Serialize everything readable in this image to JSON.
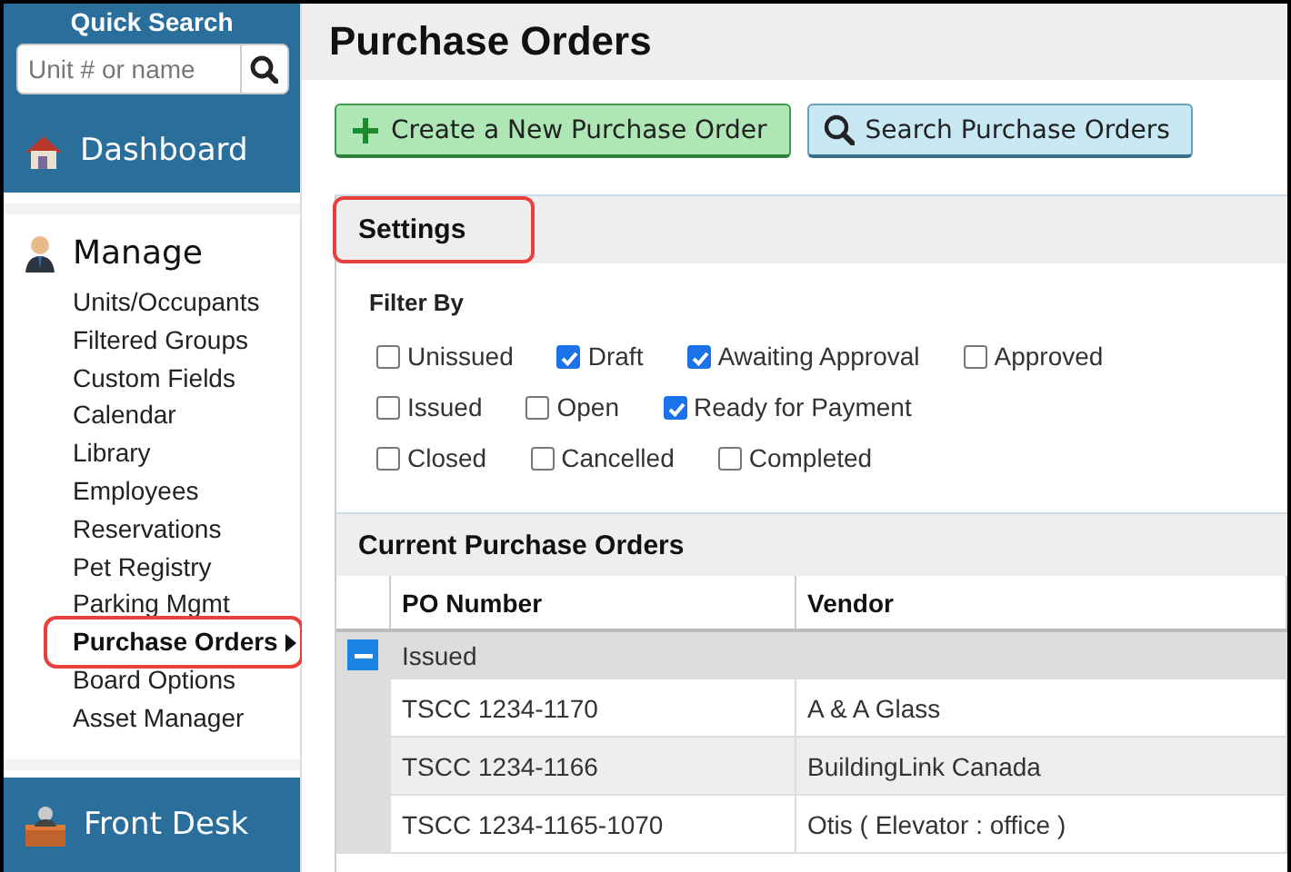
{
  "sidebar": {
    "quick_search": {
      "title": "Quick Search",
      "placeholder": "Unit # or name"
    },
    "dashboard": {
      "label": "Dashboard"
    },
    "manage": {
      "label": "Manage",
      "items": [
        {
          "label": "Units/Occupants",
          "selected": false,
          "highlighted": false
        },
        {
          "label": "Filtered Groups",
          "selected": false,
          "highlighted": false
        },
        {
          "label": "Custom Fields",
          "selected": false,
          "highlighted": false
        },
        {
          "label": "Calendar",
          "selected": false,
          "highlighted": false
        },
        {
          "label": "Library",
          "selected": false,
          "highlighted": false
        },
        {
          "label": "Employees",
          "selected": false,
          "highlighted": false
        },
        {
          "label": "Reservations",
          "selected": false,
          "highlighted": false
        },
        {
          "label": "Pet Registry",
          "selected": false,
          "highlighted": false
        },
        {
          "label": "Parking Mgmt",
          "selected": false,
          "highlighted": false
        },
        {
          "label": "Purchase Orders",
          "selected": true,
          "highlighted": true
        },
        {
          "label": "Board Options",
          "selected": false,
          "highlighted": false
        },
        {
          "label": "Asset Manager",
          "selected": false,
          "highlighted": false
        }
      ]
    },
    "front_desk": {
      "label": "Front Desk"
    }
  },
  "main": {
    "title": "Purchase Orders",
    "buttons": [
      {
        "label": "Create a New Purchase Order",
        "kind": "create"
      },
      {
        "label": "Search Purchase Orders",
        "kind": "search"
      }
    ],
    "settings": {
      "title": "Settings",
      "highlighted": true,
      "filter_label": "Filter By",
      "filter_rows": [
        [
          {
            "label": "Unissued",
            "checked": false
          },
          {
            "label": "Draft",
            "checked": true
          },
          {
            "label": "Awaiting Approval",
            "checked": true
          },
          {
            "label": "Approved",
            "checked": false
          }
        ],
        [
          {
            "label": "Issued",
            "checked": false
          },
          {
            "label": "Open",
            "checked": false
          },
          {
            "label": "Ready for Payment",
            "checked": true
          }
        ],
        [
          {
            "label": "Closed",
            "checked": false
          },
          {
            "label": "Cancelled",
            "checked": false
          },
          {
            "label": "Completed",
            "checked": false
          }
        ]
      ]
    },
    "orders": {
      "title": "Current Purchase Orders",
      "columns": [
        "PO Number",
        "Vendor"
      ],
      "groups": [
        {
          "label": "Issued",
          "expanded": true,
          "rows": [
            {
              "po_number": "TSCC 1234-1170",
              "vendor": "A & A Glass"
            },
            {
              "po_number": "TSCC 1234-1166",
              "vendor": "BuildingLink Canada"
            },
            {
              "po_number": "TSCC 1234-1165-1070",
              "vendor": "Otis ( Elevator : office )"
            }
          ]
        }
      ]
    }
  }
}
